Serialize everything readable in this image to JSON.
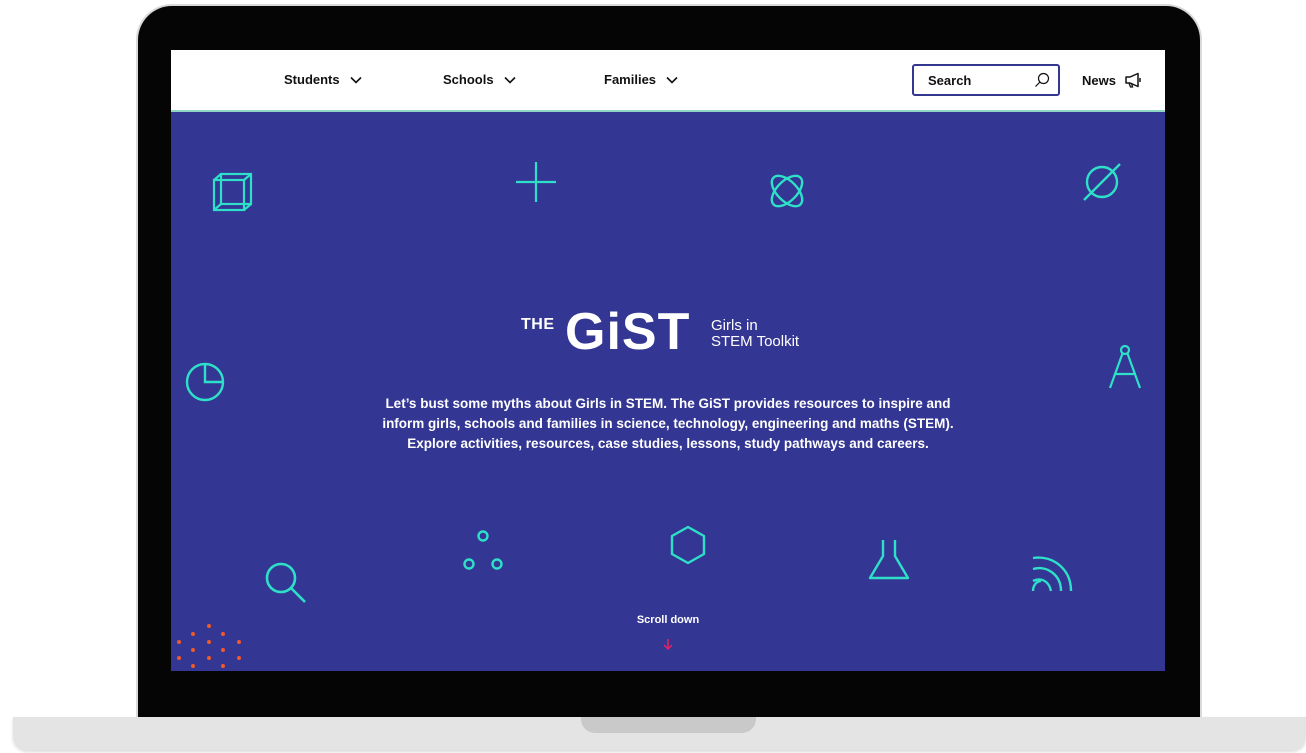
{
  "nav": {
    "items": [
      {
        "label": "Students"
      },
      {
        "label": "Schools"
      },
      {
        "label": "Families"
      }
    ],
    "search": {
      "placeholder": "Search"
    },
    "news_label": "News"
  },
  "logo": {
    "prefix": "THE",
    "name": "GiST",
    "subtitle_line1": "Girls in",
    "subtitle_line2": "STEM Toolkit"
  },
  "hero": {
    "line1": "Let’s bust some myths about Girls in STEM. The GiST provides resources to inspire and",
    "line2": "inform girls, schools and families in science, technology, engineering and maths (STEM).",
    "line3": "Explore activities, resources, case studies, lessons, study pathways and careers."
  },
  "scroll": {
    "label": "Scroll down"
  },
  "colors": {
    "hero_background": "#343693",
    "icon_teal": "#2fe0c8",
    "dots_orange": "#f05a28",
    "arrow_red": "#e8215f",
    "nav_background": "#ffffff"
  },
  "icons": [
    "cube-icon",
    "plus-icon",
    "atom-icon",
    "empty-set-icon",
    "pie-chart-icon",
    "compass-icon",
    "magnifier-icon",
    "molecule-icon",
    "hexagon-icon",
    "flask-icon",
    "signal-icon",
    "search-icon",
    "megaphone-icon",
    "chevron-down-icon",
    "arrow-down-icon"
  ]
}
